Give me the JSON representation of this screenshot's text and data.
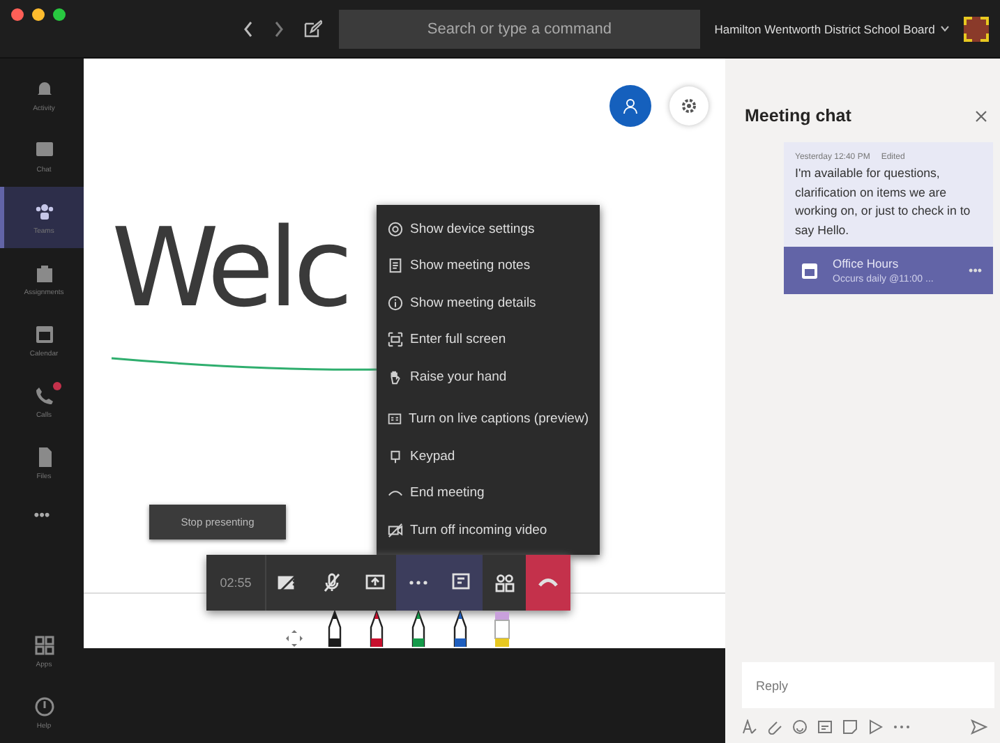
{
  "title_bar": {
    "search": {
      "placeholder": "Search or type a command"
    },
    "organization": "Hamilton Wentworth District School Board"
  },
  "app_bar": {
    "items": [
      {
        "kind": "bell",
        "label": "Activity",
        "selected": false,
        "badge": false
      },
      {
        "kind": "chat",
        "label": "Chat",
        "selected": false,
        "badge": false
      },
      {
        "kind": "teams",
        "label": "Teams",
        "selected": true,
        "badge": false
      },
      {
        "kind": "bag",
        "label": "Assignments",
        "selected": false,
        "badge": false
      },
      {
        "kind": "calendar",
        "label": "Calendar",
        "selected": false,
        "badge": false
      },
      {
        "kind": "phone",
        "label": "Calls",
        "selected": false,
        "badge": true
      },
      {
        "kind": "file",
        "label": "Files",
        "selected": false,
        "badge": false
      }
    ],
    "more": "•••",
    "bottom_items": [
      {
        "kind": "apps",
        "label": "Apps"
      },
      {
        "kind": "help",
        "label": "Help"
      }
    ]
  },
  "whiteboard": {
    "ink_text": "Welc",
    "pens": [
      {
        "kind": "pen",
        "color": "#1c1c1c"
      },
      {
        "kind": "pen",
        "color": "#c8102e"
      },
      {
        "kind": "pen",
        "color": "#159a4a"
      },
      {
        "kind": "pen",
        "color": "#1f5fbf"
      },
      {
        "kind": "highlighter",
        "color": "#e8c820"
      }
    ]
  },
  "stop_presenting": "Stop presenting",
  "more_menu": {
    "sections": [
      [
        {
          "kind": "gear",
          "label": "Show device settings"
        },
        {
          "kind": "notes",
          "label": "Show meeting notes"
        },
        {
          "kind": "info",
          "label": "Show meeting details"
        },
        {
          "kind": "fullscreen",
          "label": "Enter full screen"
        },
        {
          "kind": "hand",
          "label": "Raise your hand"
        }
      ],
      [
        {
          "kind": "cc",
          "label": "Turn on live captions (preview)"
        },
        {
          "kind": "keypad",
          "label": "Keypad"
        },
        {
          "kind": "hangup",
          "label": "End meeting"
        },
        {
          "kind": "video",
          "label": "Turn off incoming video"
        }
      ]
    ]
  },
  "call_controls": {
    "timer": "02:55",
    "buttons": [
      {
        "kind": "camera-off",
        "selected": false
      },
      {
        "kind": "mic-off",
        "selected": false
      },
      {
        "kind": "share",
        "selected": false
      },
      {
        "kind": "more",
        "selected": true
      },
      {
        "kind": "chat",
        "selected": true
      },
      {
        "kind": "people",
        "selected": false
      },
      {
        "kind": "hangup",
        "selected": false
      }
    ]
  },
  "chat": {
    "title": "Meeting chat",
    "message": {
      "time": "Yesterday 12:40 PM",
      "edited": "Edited",
      "text": "I'm available for questions, clarification on items we are working on, or just to check in to say Hello.",
      "card": {
        "title": "Office Hours",
        "subtitle": "Occurs daily @11:00 ...",
        "more": "•••"
      }
    },
    "reply": {
      "placeholder": "Reply"
    }
  }
}
